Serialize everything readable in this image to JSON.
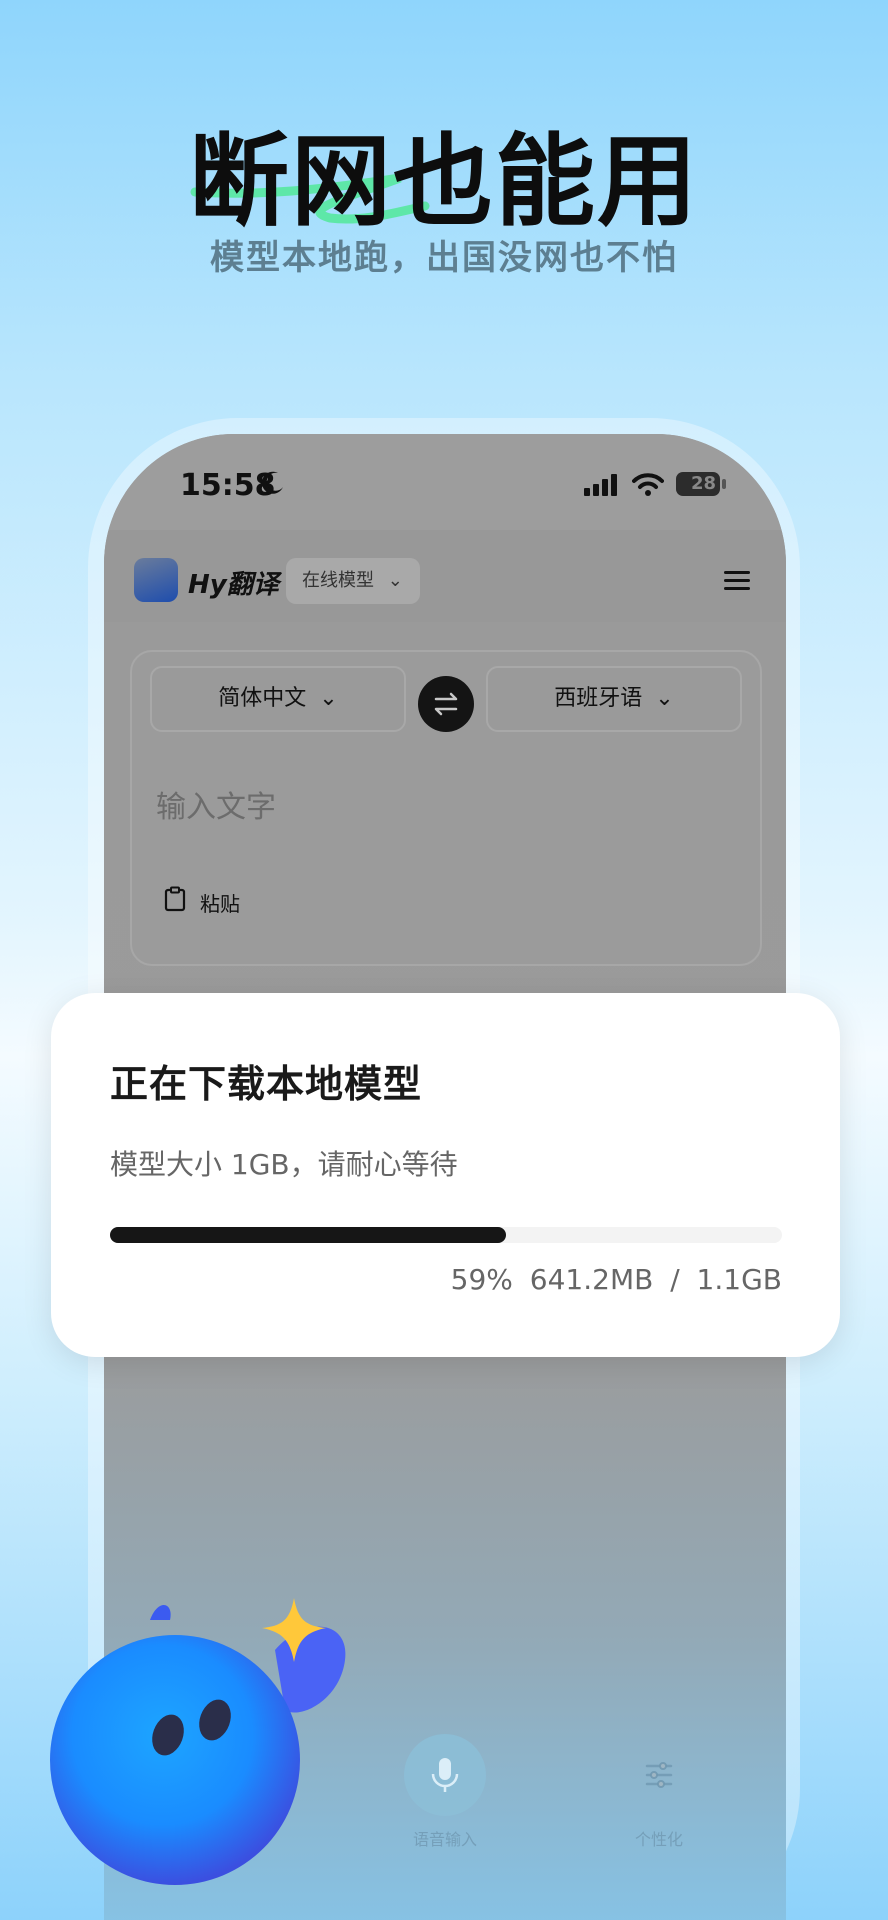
{
  "promo": {
    "headline": "断网也能用",
    "subtitle": "模型本地跑，出国没网也不怕"
  },
  "status_bar": {
    "time": "15:58",
    "battery": "28"
  },
  "app": {
    "name": "Hy翻译",
    "model_selector": "在线模型"
  },
  "translator": {
    "source_lang": "简体中文",
    "target_lang": "西班牙语",
    "input_placeholder": "输入文字",
    "paste_label": "粘贴"
  },
  "bottom_bar": {
    "voice_input_label": "语音输入",
    "customize_label": "个性化"
  },
  "dialog": {
    "title": "正在下载本地模型",
    "description": "模型大小 1GB，请耐心等待",
    "progress_percent": 59,
    "progress_text": "59%  641.2MB / 1.1GB"
  },
  "colors": {
    "accent": "#161616",
    "swoosh": "#5ee7a8",
    "sky": "#8fd5fc"
  }
}
